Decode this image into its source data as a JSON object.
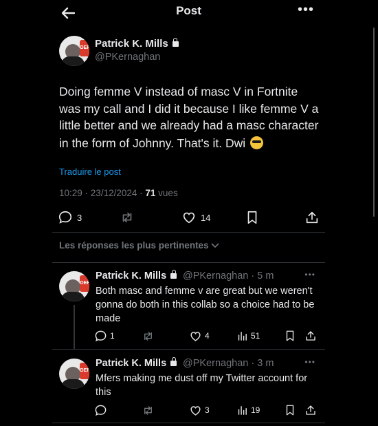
{
  "header": {
    "title": "Post"
  },
  "post": {
    "author_name": "Patrick K. Mills",
    "author_handle": "@PKernaghan",
    "text": "Doing femme V instead of masc V in Fortnite was my call and I did it because I like femme V a little better and we already had a masc character in the form of Johnny. That's it. Dwi",
    "translate_label": "Traduire le post",
    "time": "10:29",
    "date": "23/12/2024",
    "views_count": "71",
    "views_label": "vues",
    "replies": "3",
    "likes": "14"
  },
  "replies_section": {
    "label": "Les réponses les plus pertinentes"
  },
  "replies": [
    {
      "author_name": "Patrick K. Mills",
      "author_handle": "@PKernaghan",
      "time": "5 m",
      "text": "Both masc and femme v are great but we weren't gonna do both in this collab so a choice had to be made",
      "replies": "1",
      "likes": "4",
      "views": "51"
    },
    {
      "author_name": "Patrick K. Mills",
      "author_handle": "@PKernaghan",
      "time": "3 m",
      "text": "Mfers making me dust off my Twitter account for this",
      "likes": "3",
      "views": "19"
    }
  ],
  "avatar_badge": "DER",
  "colors": {
    "background": "#000000",
    "text": "#e7e9ea",
    "muted": "#71767b",
    "accent": "#1d9bf0"
  }
}
